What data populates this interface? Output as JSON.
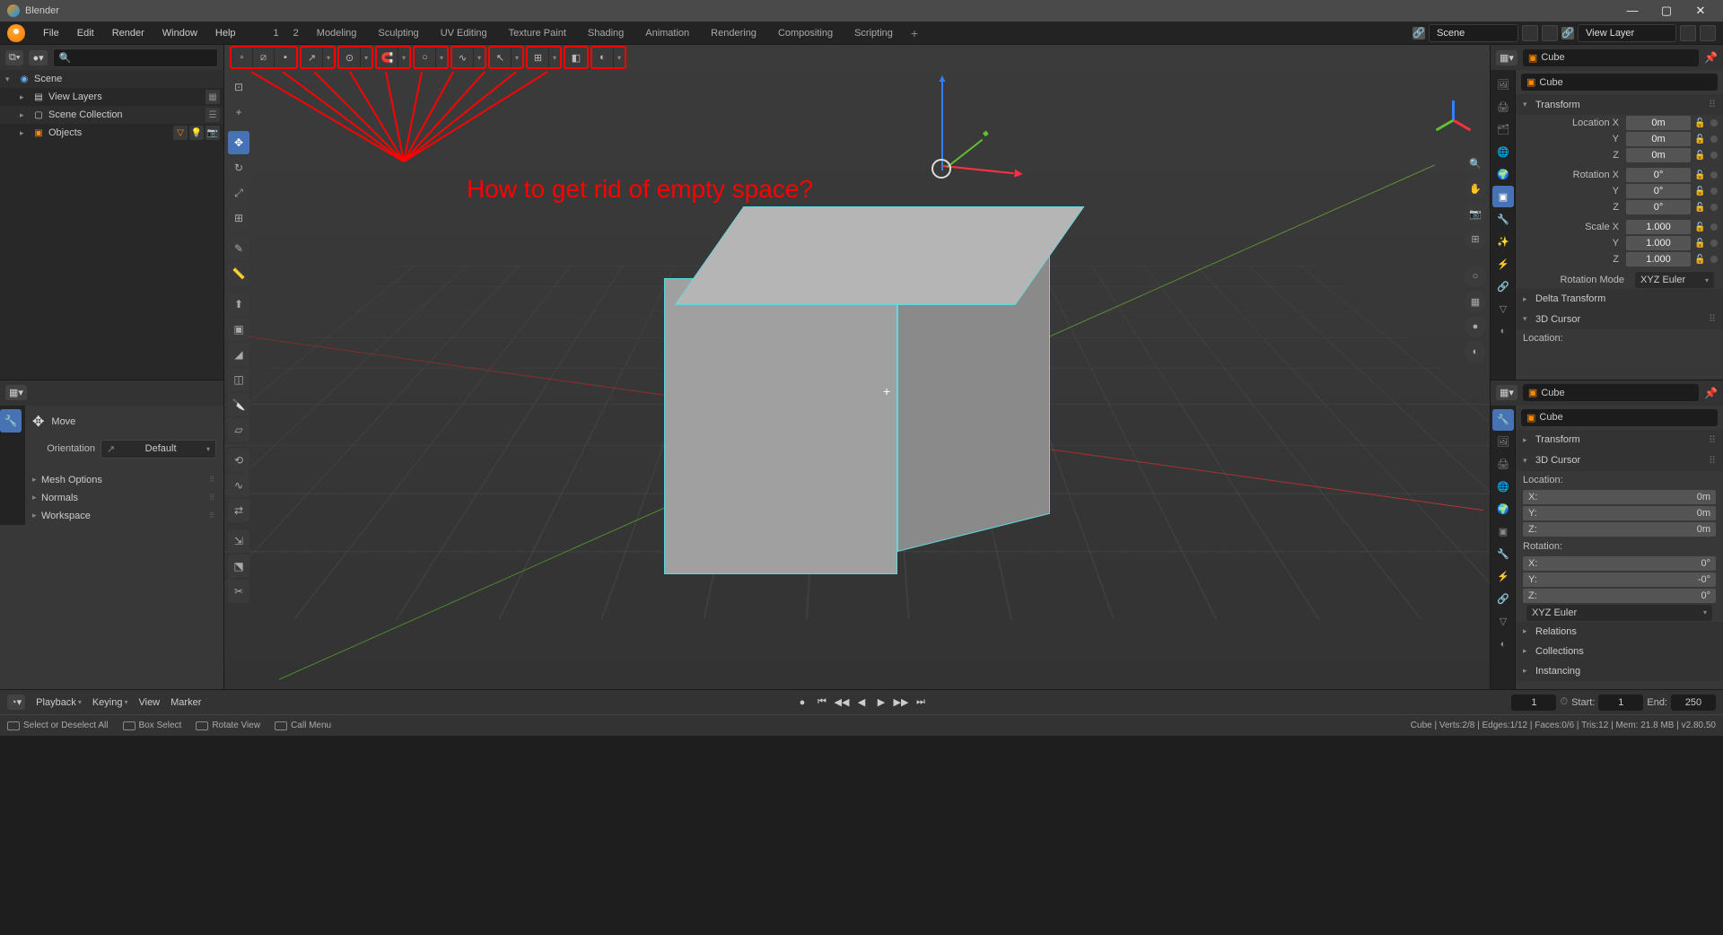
{
  "titlebar": {
    "title": "Blender"
  },
  "menubar": {
    "items": [
      "File",
      "Edit",
      "Render",
      "Window",
      "Help"
    ]
  },
  "workspaces": {
    "nums": [
      "1",
      "2"
    ],
    "tabs": [
      "Modeling",
      "Sculpting",
      "UV Editing",
      "Texture Paint",
      "Shading",
      "Animation",
      "Rendering",
      "Compositing",
      "Scripting"
    ]
  },
  "scene_strip": {
    "scene": "Scene",
    "view_layer": "View Layer"
  },
  "outliner": {
    "search_placeholder": "",
    "rows": [
      {
        "label": "Scene",
        "indent": 0,
        "expanded": true
      },
      {
        "label": "View Layers",
        "indent": 1,
        "expanded": false
      },
      {
        "label": "Scene Collection",
        "indent": 1,
        "expanded": false
      },
      {
        "label": "Objects",
        "indent": 1,
        "expanded": false
      }
    ]
  },
  "tool_settings": {
    "tool": "Move",
    "orientation_label": "Orientation",
    "orientation_value": "Default",
    "panels": [
      "Mesh Options",
      "Normals",
      "Workspace"
    ]
  },
  "viewport_header_groups": [
    [
      "vertex",
      "edge",
      "face"
    ],
    [
      "global-dd"
    ],
    [
      "pivot-dd"
    ],
    [
      "snap",
      "snap-dd"
    ],
    [
      "proportional",
      "prop-dd"
    ],
    [
      "visibility-dd"
    ],
    [
      "gizmo",
      "gizmo-dd"
    ],
    [
      "overlay",
      "overlay-dd"
    ],
    [
      "xray"
    ],
    [
      "shading",
      "shading-dd"
    ]
  ],
  "left_toolbar_icons": [
    "⊹",
    "▭",
    "◯",
    "⊘",
    "+",
    "↗",
    "↻",
    "⤢",
    "▦",
    "⊡",
    "⬚",
    "⊞",
    "⟲",
    "◐",
    "✂",
    "⊕",
    "◧",
    "≡",
    "▥"
  ],
  "right_nav_icons": [
    "🔍",
    "✋",
    "📷",
    "⊞",
    "○",
    "▦",
    "●",
    "◐"
  ],
  "annotation_text": "How to get rid of empty space?",
  "properties": {
    "object_name": "Cube",
    "breadcrumb": "Cube",
    "transform": {
      "title": "Transform",
      "loc": {
        "label": "Location X",
        "x": "0m",
        "y": "0m",
        "z": "0m",
        "yl": "Y",
        "zl": "Z"
      },
      "rot": {
        "label": "Rotation X",
        "x": "0°",
        "y": "0°",
        "z": "0°",
        "yl": "Y",
        "zl": "Z"
      },
      "scale": {
        "label": "Scale X",
        "x": "1.000",
        "y": "1.000",
        "z": "1.000",
        "yl": "Y",
        "zl": "Z"
      },
      "rotation_mode_label": "Rotation Mode",
      "rotation_mode": "XYZ Euler"
    },
    "delta_transform": "Delta Transform",
    "cursor3d_title": "3D Cursor",
    "cursor3d_location_label": "Location:"
  },
  "properties2": {
    "object_name": "Cube",
    "breadcrumb": "Cube",
    "transform": "Transform",
    "cursor3d": "3D Cursor",
    "location_label": "Location:",
    "loc": {
      "x": "X:",
      "xv": "0m",
      "y": "Y:",
      "yv": "0m",
      "z": "Z:",
      "zv": "0m"
    },
    "rotation_label": "Rotation:",
    "rot": {
      "x": "X:",
      "xv": "0°",
      "y": "Y:",
      "yv": "-0°",
      "z": "Z:",
      "zv": "0°"
    },
    "euler": "XYZ Euler",
    "relations": "Relations",
    "collections": "Collections",
    "instancing": "Instancing"
  },
  "prop_tabs_icons": [
    "🔧",
    "🖨",
    "🌐",
    "▦",
    "🎬",
    "◈",
    "⊞",
    "▥",
    "🔘",
    "◐",
    "💡",
    "🔧"
  ],
  "timeline": {
    "menus": [
      "Playback",
      "Keying",
      "View",
      "Marker"
    ],
    "current": "1",
    "start_label": "Start:",
    "start": "1",
    "end_label": "End:",
    "end": "250"
  },
  "statusbar": {
    "left": [
      "Select or Deselect All",
      "Box Select",
      "Rotate View",
      "Call Menu"
    ],
    "right": "Cube | Verts:2/8 | Edges:1/12 | Faces:0/6 | Tris:12 | Mem: 21.8 MB | v2.80.50"
  }
}
